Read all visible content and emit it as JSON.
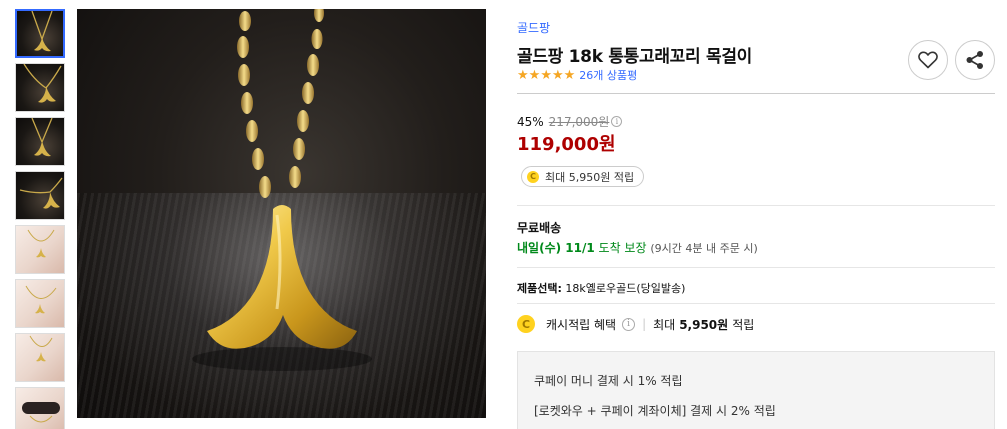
{
  "product": {
    "brand": "골드팡",
    "title": "골드팡 18k 통통고래꼬리 목걸이",
    "rating_stars": 5,
    "review_count": "26개 상품평"
  },
  "price": {
    "discount": "45%",
    "original": "217,000원",
    "sale": "119,000원",
    "reward_chip": "최대 5,950원 적립"
  },
  "shipping": {
    "label": "무료배송",
    "date": "내일(수) 11/1",
    "guarantee": "도착 보장",
    "cutoff": "(9시간 4분 내 주문 시)"
  },
  "option": {
    "label": "제품선택:",
    "value": "18k옐로우골드(당일발송)"
  },
  "cash": {
    "label": "캐시적립 혜택",
    "max_label": "최대",
    "max_value": "5,950원",
    "suffix": "적립"
  },
  "pay_box": {
    "line1": "쿠페이 머니 결제 시 1% 적립",
    "line2": "[로켓와우 + 쿠페이 계좌이체] 결제 시 2% 적립"
  },
  "icons": {
    "heart": "heart-icon",
    "share": "share-icon",
    "coin_glyph": "C",
    "info_glyph": "i",
    "star_glyph": "★"
  },
  "colors": {
    "brand_link": "#346aff",
    "sale_price": "#ae0000",
    "delivery_green": "#00891a",
    "star": "#f5a623",
    "coin": "#ffd21f"
  },
  "thumbnails": [
    {
      "kind": "dark",
      "selected": true
    },
    {
      "kind": "dark",
      "selected": false
    },
    {
      "kind": "dark",
      "selected": false
    },
    {
      "kind": "dark",
      "selected": false
    },
    {
      "kind": "light",
      "selected": false
    },
    {
      "kind": "light",
      "selected": false
    },
    {
      "kind": "light",
      "selected": false
    },
    {
      "kind": "light",
      "selected": false
    }
  ]
}
